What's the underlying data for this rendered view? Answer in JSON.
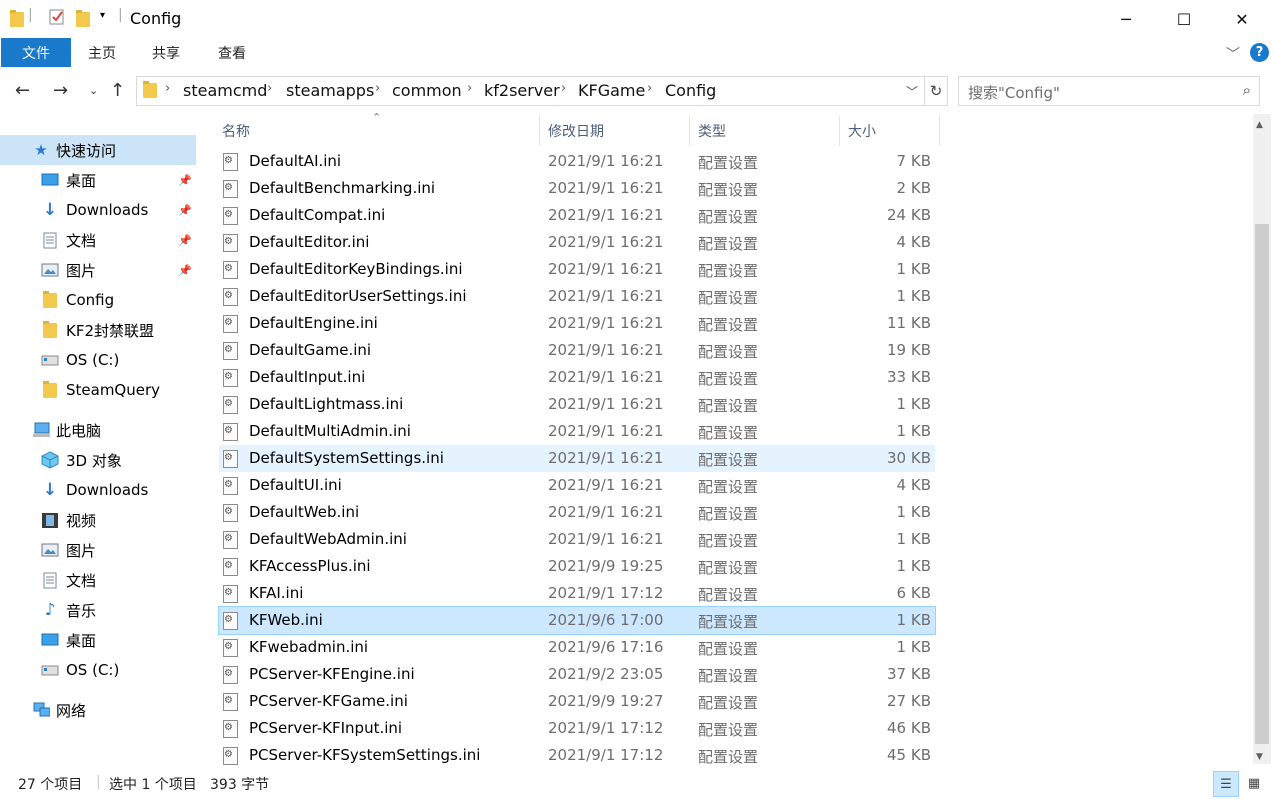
{
  "window": {
    "title": "Config",
    "minimize_icon": "minimize-icon",
    "maximize_icon": "maximize-icon",
    "close_icon": "close-icon"
  },
  "ribbon": {
    "tabs": [
      "文件",
      "主页",
      "共享",
      "查看"
    ],
    "accent": "#1979ca",
    "help_label": "?"
  },
  "address": {
    "crumbs": [
      "steamcmd",
      "steamapps",
      "common",
      "kf2server",
      "KFGame",
      "Config"
    ]
  },
  "search": {
    "placeholder": "搜索\"Config\""
  },
  "navpane": {
    "quick_access": {
      "label": "快速访问",
      "items": [
        {
          "label": "桌面",
          "icon": "desktop-icon",
          "pinned": true
        },
        {
          "label": "Downloads",
          "icon": "download-arrow-icon",
          "pinned": true
        },
        {
          "label": "文档",
          "icon": "document-icon",
          "pinned": true
        },
        {
          "label": "图片",
          "icon": "picture-icon",
          "pinned": true
        },
        {
          "label": "Config",
          "icon": "folder-icon",
          "pinned": false
        },
        {
          "label": "KF2封禁联盟",
          "icon": "folder-icon",
          "pinned": false
        },
        {
          "label": "OS (C:)",
          "icon": "drive-icon",
          "pinned": false
        },
        {
          "label": "SteamQuery",
          "icon": "folder-icon",
          "pinned": false
        }
      ]
    },
    "this_pc": {
      "label": "此电脑",
      "items": [
        {
          "label": "3D 对象",
          "icon": "cube-icon"
        },
        {
          "label": "Downloads",
          "icon": "download-arrow-icon"
        },
        {
          "label": "视频",
          "icon": "film-icon"
        },
        {
          "label": "图片",
          "icon": "picture-icon"
        },
        {
          "label": "文档",
          "icon": "document-icon"
        },
        {
          "label": "音乐",
          "icon": "music-note-icon"
        },
        {
          "label": "桌面",
          "icon": "desktop-icon"
        },
        {
          "label": "OS (C:)",
          "icon": "drive-icon"
        }
      ]
    },
    "network": {
      "label": "网络",
      "icon": "network-icon"
    }
  },
  "filelist": {
    "columns": [
      "名称",
      "修改日期",
      "类型",
      "大小"
    ],
    "rows": [
      {
        "name": "DefaultAI.ini",
        "date": "2021/9/1 16:21",
        "type": "配置设置",
        "size": "7 KB"
      },
      {
        "name": "DefaultBenchmarking.ini",
        "date": "2021/9/1 16:21",
        "type": "配置设置",
        "size": "2 KB"
      },
      {
        "name": "DefaultCompat.ini",
        "date": "2021/9/1 16:21",
        "type": "配置设置",
        "size": "24 KB"
      },
      {
        "name": "DefaultEditor.ini",
        "date": "2021/9/1 16:21",
        "type": "配置设置",
        "size": "4 KB"
      },
      {
        "name": "DefaultEditorKeyBindings.ini",
        "date": "2021/9/1 16:21",
        "type": "配置设置",
        "size": "1 KB"
      },
      {
        "name": "DefaultEditorUserSettings.ini",
        "date": "2021/9/1 16:21",
        "type": "配置设置",
        "size": "1 KB"
      },
      {
        "name": "DefaultEngine.ini",
        "date": "2021/9/1 16:21",
        "type": "配置设置",
        "size": "11 KB"
      },
      {
        "name": "DefaultGame.ini",
        "date": "2021/9/1 16:21",
        "type": "配置设置",
        "size": "19 KB"
      },
      {
        "name": "DefaultInput.ini",
        "date": "2021/9/1 16:21",
        "type": "配置设置",
        "size": "33 KB"
      },
      {
        "name": "DefaultLightmass.ini",
        "date": "2021/9/1 16:21",
        "type": "配置设置",
        "size": "1 KB"
      },
      {
        "name": "DefaultMultiAdmin.ini",
        "date": "2021/9/1 16:21",
        "type": "配置设置",
        "size": "1 KB"
      },
      {
        "name": "DefaultSystemSettings.ini",
        "date": "2021/9/1 16:21",
        "type": "配置设置",
        "size": "30 KB",
        "state": "hover"
      },
      {
        "name": "DefaultUI.ini",
        "date": "2021/9/1 16:21",
        "type": "配置设置",
        "size": "4 KB"
      },
      {
        "name": "DefaultWeb.ini",
        "date": "2021/9/1 16:21",
        "type": "配置设置",
        "size": "1 KB"
      },
      {
        "name": "DefaultWebAdmin.ini",
        "date": "2021/9/1 16:21",
        "type": "配置设置",
        "size": "1 KB"
      },
      {
        "name": "KFAccessPlus.ini",
        "date": "2021/9/9 19:25",
        "type": "配置设置",
        "size": "1 KB"
      },
      {
        "name": "KFAI.ini",
        "date": "2021/9/1 17:12",
        "type": "配置设置",
        "size": "6 KB"
      },
      {
        "name": "KFWeb.ini",
        "date": "2021/9/6 17:00",
        "type": "配置设置",
        "size": "1 KB",
        "state": "selected"
      },
      {
        "name": "KFwebadmin.ini",
        "date": "2021/9/6 17:16",
        "type": "配置设置",
        "size": "1 KB"
      },
      {
        "name": "PCServer-KFEngine.ini",
        "date": "2021/9/2 23:05",
        "type": "配置设置",
        "size": "37 KB"
      },
      {
        "name": "PCServer-KFGame.ini",
        "date": "2021/9/9 19:27",
        "type": "配置设置",
        "size": "27 KB"
      },
      {
        "name": "PCServer-KFInput.ini",
        "date": "2021/9/1 17:12",
        "type": "配置设置",
        "size": "46 KB"
      },
      {
        "name": "PCServer-KFSystemSettings.ini",
        "date": "2021/9/1 17:12",
        "type": "配置设置",
        "size": "45 KB"
      }
    ]
  },
  "statusbar": {
    "item_count": "27 个项目",
    "selection": "选中 1 个项目",
    "size": "393 字节"
  }
}
